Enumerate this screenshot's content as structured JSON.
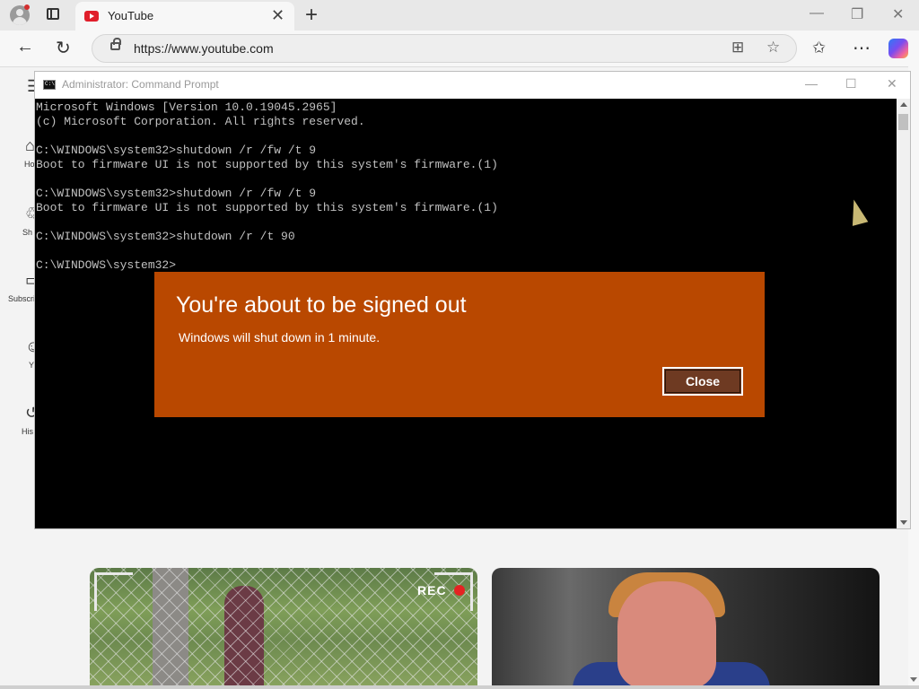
{
  "browser": {
    "tab": {
      "title": "YouTube"
    },
    "address_bar": {
      "url": "https://www.youtube.com"
    }
  },
  "youtube_sidebar": {
    "items": [
      {
        "label": "Ho",
        "icon": "home-icon"
      },
      {
        "label": "Sh",
        "icon": "shorts-icon"
      },
      {
        "label": "Subscri",
        "icon": "subscriptions-icon"
      },
      {
        "label": "Y",
        "icon": "you-icon"
      },
      {
        "label": "His",
        "icon": "history-icon"
      }
    ]
  },
  "thumbnails": [
    {
      "overlay_text": "REC",
      "rec_color": "#e52222"
    },
    {
      "overlay_text": ""
    }
  ],
  "cmd_window": {
    "title": "Administrator: Command Prompt",
    "lines": [
      "Microsoft Windows [Version 10.0.19045.2965]",
      "(c) Microsoft Corporation. All rights reserved.",
      "",
      "C:\\WINDOWS\\system32>shutdown /r /fw /t 9",
      "Boot to firmware UI is not supported by this system's firmware.(1)",
      "",
      "C:\\WINDOWS\\system32>shutdown /r /fw /t 9",
      "Boot to firmware UI is not supported by this system's firmware.(1)",
      "",
      "C:\\WINDOWS\\system32>shutdown /r /t 90",
      "",
      "C:\\WINDOWS\\system32>"
    ]
  },
  "dialog": {
    "title": "You're about to be signed out",
    "message": "Windows will shut down in 1 minute.",
    "close_label": "Close",
    "background_color": "#b94800"
  },
  "colors": {
    "youtube_red": "#e01e2a",
    "console_text": "#c0c0c0",
    "console_bg": "#000000"
  }
}
